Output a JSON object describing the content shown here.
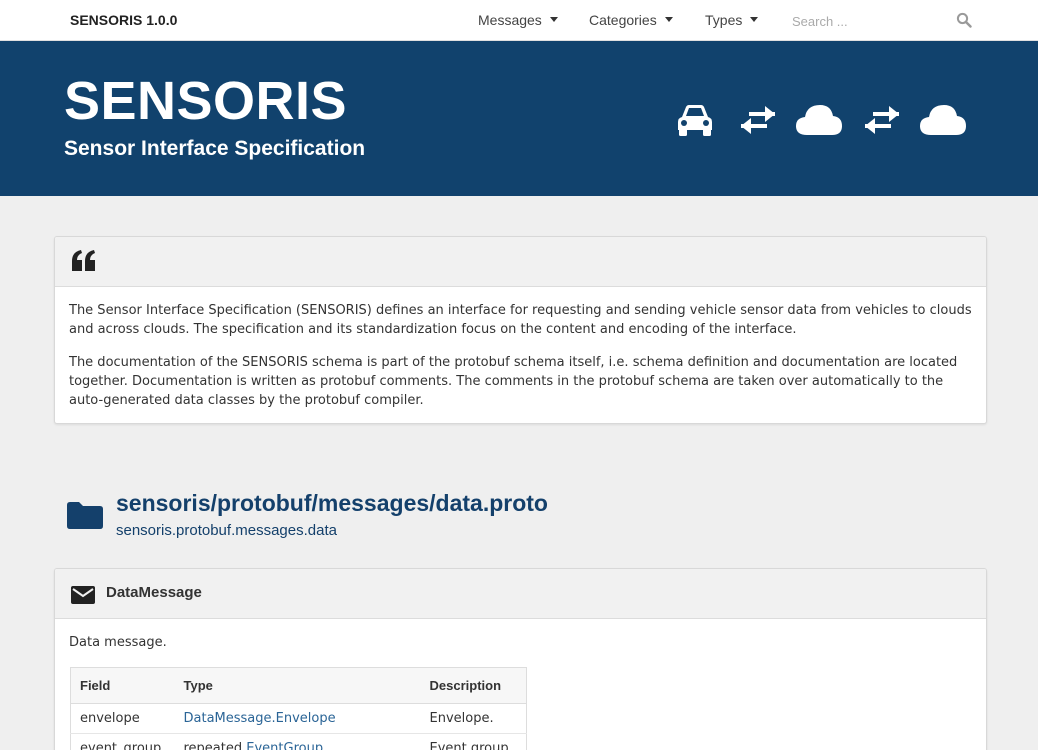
{
  "navbar": {
    "brand": "SENSORIS 1.0.0",
    "menus": [
      {
        "label": "Messages"
      },
      {
        "label": "Categories"
      },
      {
        "label": "Types"
      }
    ],
    "search": {
      "placeholder": "Search ...",
      "value": ""
    }
  },
  "hero": {
    "title": "SENSORIS",
    "subtitle": "Sensor Interface Specification",
    "icons": [
      "car-icon",
      "exchange-icon",
      "cloud-icon",
      "exchange-icon",
      "cloud-icon"
    ]
  },
  "intro": {
    "icon": "quote-left-icon",
    "paragraphs": [
      "The Sensor Interface Specification (SENSORIS) defines an interface for requesting and sending vehicle sensor data from vehicles to clouds and across clouds. The specification and its standardization focus on the content and encoding of the interface.",
      "The documentation of the SENSORIS schema is part of the protobuf schema itself, i.e. schema definition and documentation are located together. Documentation is written as protobuf comments. The comments in the protobuf schema are taken over automatically to the auto-generated data classes by the protobuf compiler."
    ]
  },
  "file": {
    "icon": "folder-icon",
    "path": "sensoris/protobuf/messages/data.proto",
    "package": "sensoris.protobuf.messages.data"
  },
  "message": {
    "icon": "envelope-icon",
    "name": "DataMessage",
    "description": "Data message.",
    "table": {
      "headers": [
        "Field",
        "Type",
        "Description"
      ],
      "rows": [
        {
          "field": "envelope",
          "type_prefix": "",
          "type_link": "DataMessage.Envelope",
          "description": "Envelope."
        },
        {
          "field": "event_group",
          "type_prefix": "repeated ",
          "type_link": "EventGroup",
          "description": "Event group."
        }
      ]
    }
  },
  "colors": {
    "hero_bg": "#11426d",
    "link": "#2a6496",
    "page_bg": "#efefef"
  }
}
